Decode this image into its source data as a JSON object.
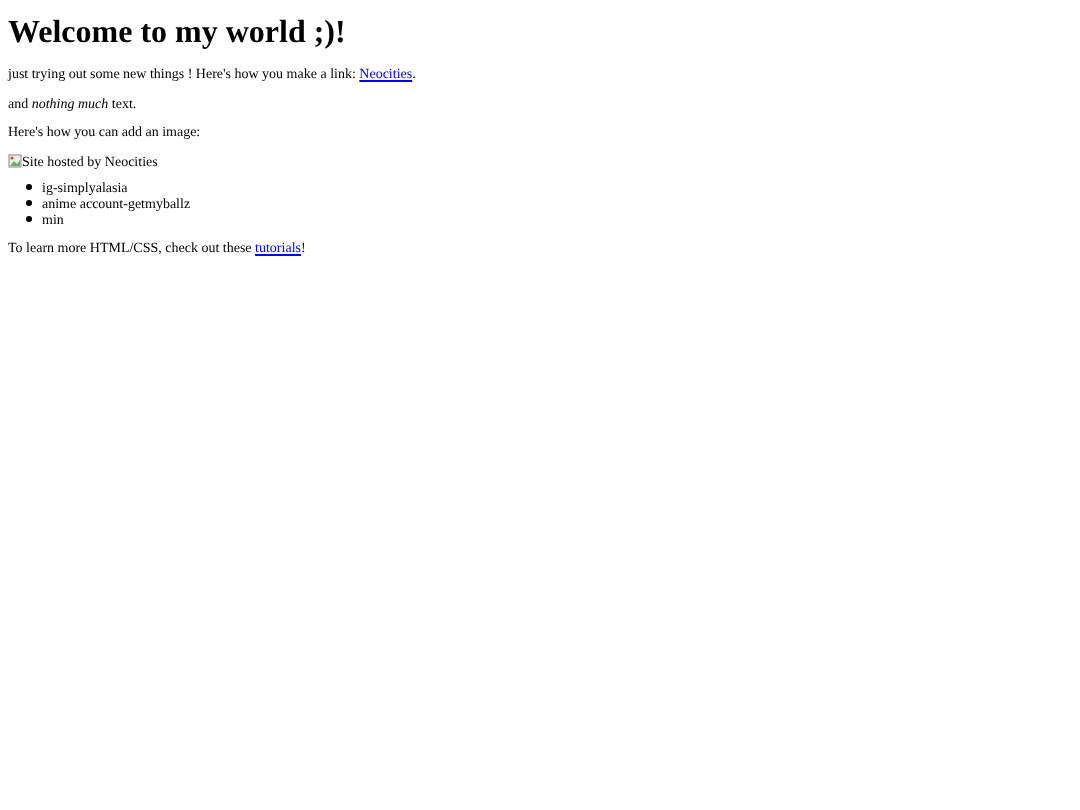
{
  "heading": "Welcome to my world ;)!",
  "intro": {
    "text": "just trying out some new things ! Here's how you make a link: ",
    "link": "Neocities",
    "after": "."
  },
  "note": "and *nothing much* text.",
  "image_intro": "Here's how you can add an image:",
  "image": {
    "kind": "picture",
    "alt": "Site hosted by Neocities"
  },
  "list": [
    "ig-simplyalasia",
    "anime account-getmyballz",
    "min"
  ],
  "outro": {
    "text": "To learn more HTML/CSS, check out these ",
    "link": "tutorials",
    "after": "!"
  }
}
